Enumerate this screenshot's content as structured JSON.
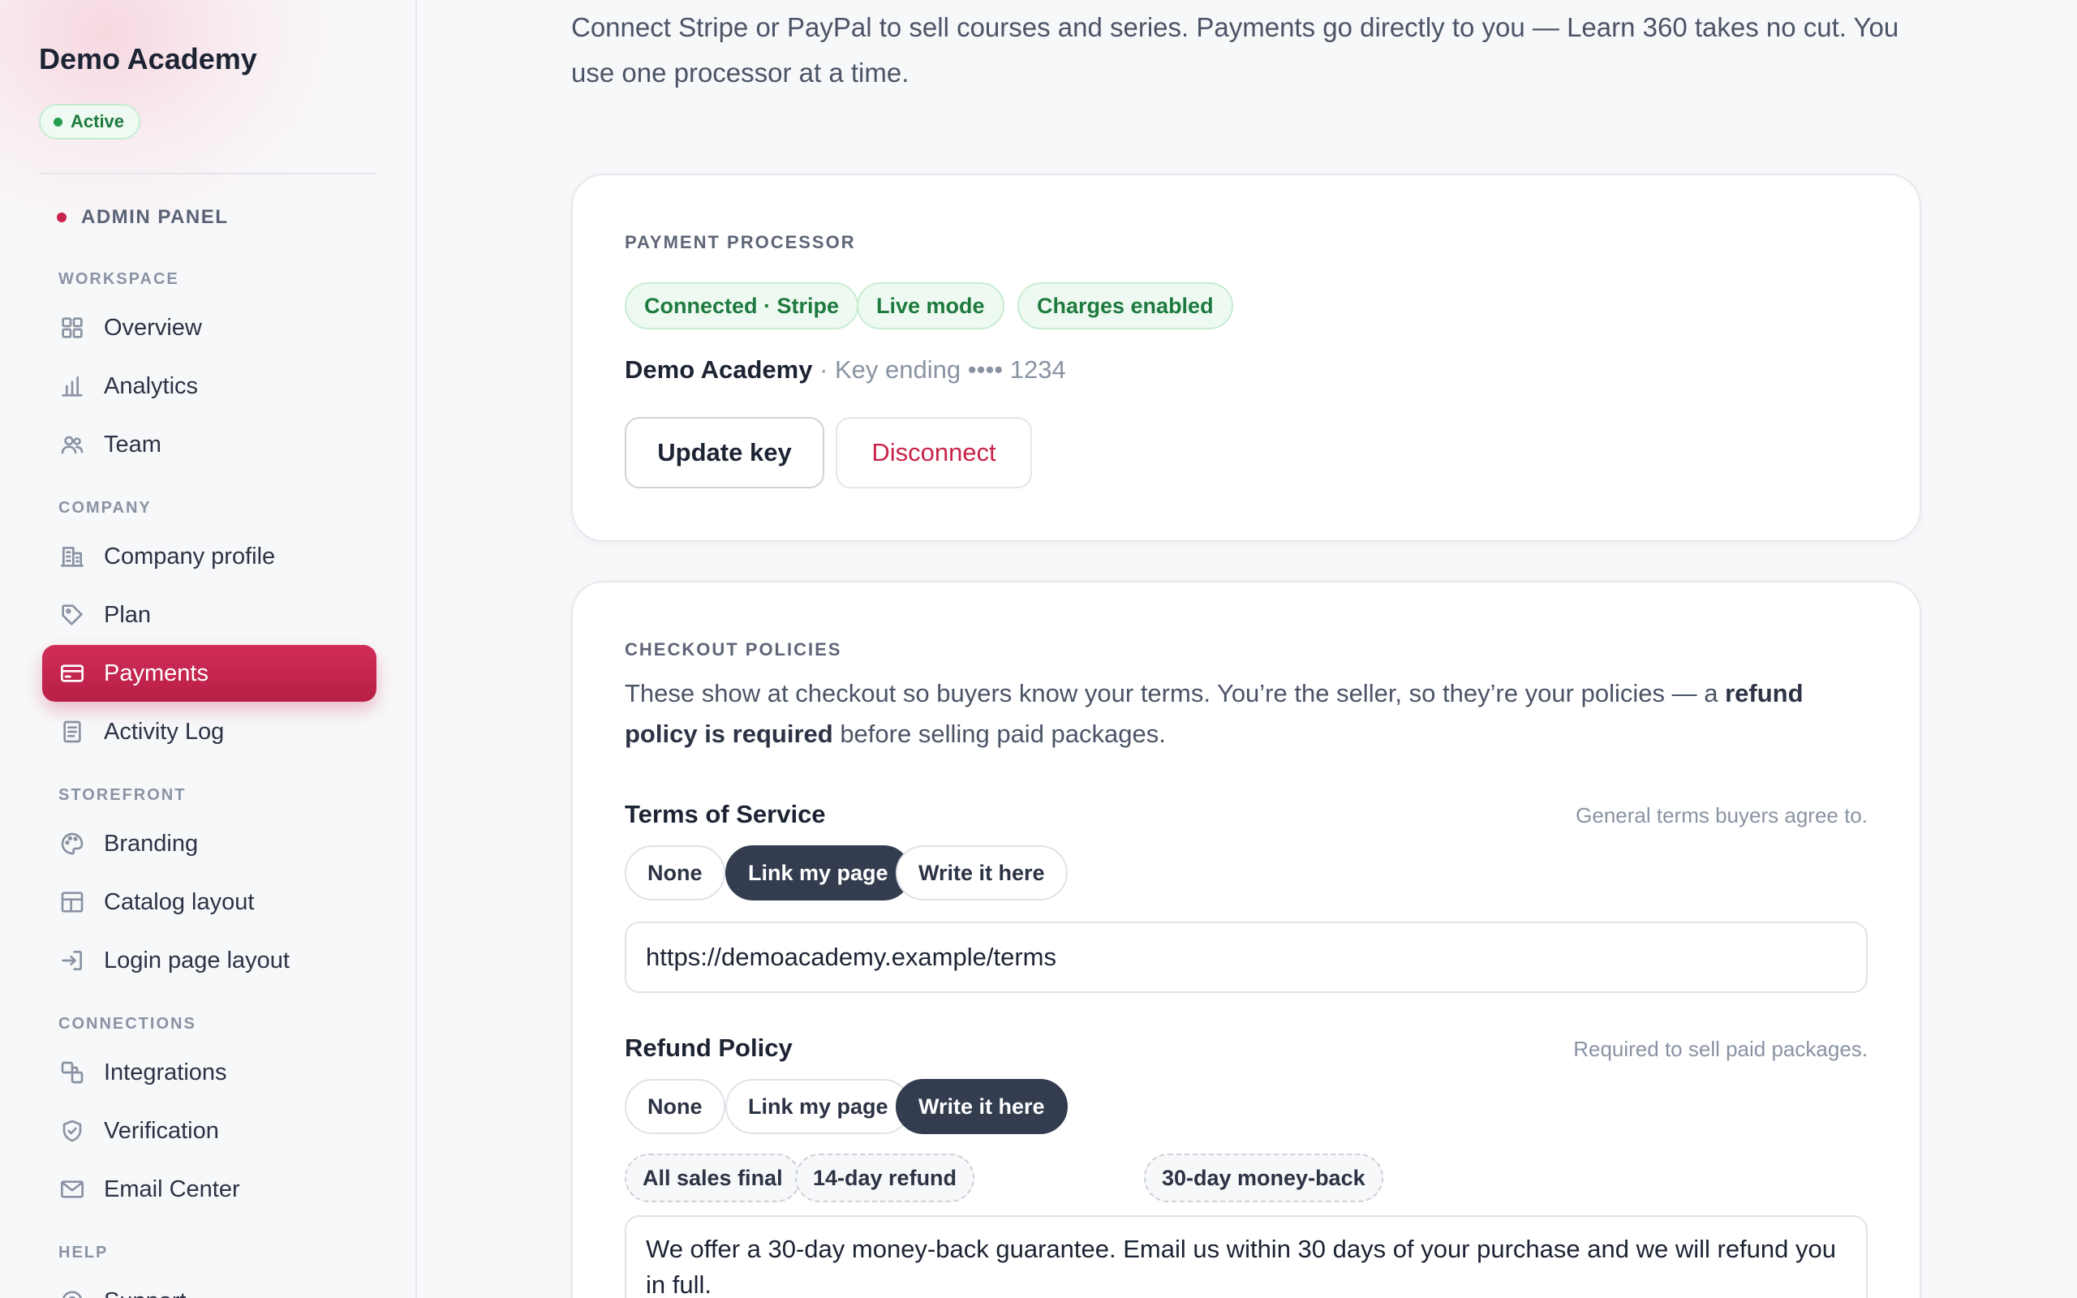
{
  "sidebar": {
    "brand": "Demo Academy",
    "status": "Active",
    "panel_label": "ADMIN PANEL",
    "sections": {
      "workspace": "WORKSPACE",
      "company": "COMPANY",
      "storefront": "STOREFRONT",
      "connections": "CONNECTIONS",
      "help": "HELP"
    },
    "items": {
      "overview": {
        "label": "Overview",
        "icon": "grid-icon"
      },
      "analytics": {
        "label": "Analytics",
        "icon": "bar-chart-icon"
      },
      "team": {
        "label": "Team",
        "icon": "users-icon"
      },
      "company_profile": {
        "label": "Company profile",
        "icon": "building-icon"
      },
      "plan": {
        "label": "Plan",
        "icon": "tag-icon"
      },
      "payments": {
        "label": "Payments",
        "icon": "credit-card-icon",
        "active": true
      },
      "activity_log": {
        "label": "Activity Log",
        "icon": "document-icon"
      },
      "branding": {
        "label": "Branding",
        "icon": "palette-icon"
      },
      "catalog_layout": {
        "label": "Catalog layout",
        "icon": "layout-icon"
      },
      "login_page_layout": {
        "label": "Login page layout",
        "icon": "login-icon"
      },
      "integrations": {
        "label": "Integrations",
        "icon": "integrations-icon"
      },
      "verification": {
        "label": "Verification",
        "icon": "shield-check-icon"
      },
      "email_center": {
        "label": "Email Center",
        "icon": "mail-icon"
      },
      "support": {
        "label": "Support",
        "icon": "support-icon"
      }
    }
  },
  "main": {
    "intro": "Connect Stripe or PayPal to sell courses and series. Payments go directly to you — Learn 360 takes no cut. You use one processor at a time.",
    "processor": {
      "label": "PAYMENT PROCESSOR",
      "badges": [
        "Connected · Stripe",
        "Live mode",
        "Charges enabled"
      ],
      "account_name": "Demo Academy",
      "account_meta": " · Key ending •••• 1234",
      "update_button": "Update key",
      "disconnect_button": "Disconnect"
    },
    "policies": {
      "label": "CHECKOUT POLICIES",
      "desc_part1": "These show at checkout so buyers know your terms. You’re the seller, so they’re your policies — a ",
      "desc_bold": "refund policy is required",
      "desc_part2": " before selling paid packages.",
      "terms": {
        "title": "Terms of Service",
        "hint": "General terms buyers agree to.",
        "options": [
          "None",
          "Link my page",
          "Write it here"
        ],
        "selected": "Link my page",
        "url_value": "https://demoacademy.example/terms"
      },
      "refund": {
        "title": "Refund Policy",
        "hint": "Required to sell paid packages.",
        "options": [
          "None",
          "Link my page",
          "Write it here"
        ],
        "selected": "Write it here",
        "presets": [
          "All sales final",
          "14-day refund",
          "30-day money-back"
        ],
        "text_value": "We offer a 30-day money-back guarantee. Email us within 30 days of your purchase and we will refund you in full."
      }
    }
  },
  "colors": {
    "accent": "#c8234a",
    "success": "#1e7a3e",
    "selected_segment": "#333d4f"
  }
}
